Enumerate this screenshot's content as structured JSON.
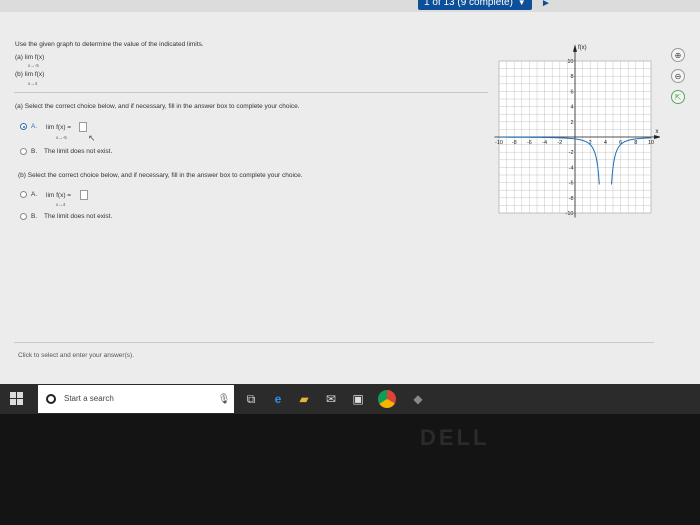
{
  "progress": {
    "label": "1 of 13 (9 complete)"
  },
  "question": {
    "instruction": "Use the given graph to determine the value of the indicated limits.",
    "parts": [
      {
        "label": "(a)",
        "expr": "lim f(x)",
        "approach": "x→-5"
      },
      {
        "label": "(b)",
        "expr": "lim f(x)",
        "approach": "x→4"
      }
    ]
  },
  "part_a": {
    "prompt": "(a) Select the correct choice below, and if necessary, fill in the answer box to complete your choice.",
    "option_a_label": "A.",
    "option_a_expr": "lim f(x) =",
    "option_a_approach": "x→-5",
    "option_b_label": "B.",
    "option_b_text": "The limit does not exist.",
    "selected": "A"
  },
  "part_b": {
    "prompt": "(b) Select the correct choice below, and if necessary, fill in the answer box to complete your choice.",
    "option_a_label": "A.",
    "option_a_expr": "lim f(x) =",
    "option_a_approach": "x→4",
    "option_b_label": "B.",
    "option_b_text": "The limit does not exist.",
    "selected": ""
  },
  "graph": {
    "y_axis_label": "f(x)",
    "x_axis_label": "x",
    "x_ticks": [
      "-10",
      "-8",
      "-6",
      "-4",
      "-2",
      "2",
      "4",
      "6",
      "8",
      "10"
    ],
    "y_ticks": [
      "10",
      "8",
      "6",
      "4",
      "2",
      "-2",
      "-4",
      "-6",
      "-8",
      "-10"
    ],
    "range": [
      -10,
      10
    ]
  },
  "side_icons": [
    "zoom-in-icon",
    "zoom-out-icon",
    "external-link-icon"
  ],
  "footer": {
    "text": "Click to select and enter your answer(s)."
  },
  "taskbar": {
    "search_placeholder": "Start a search",
    "icons": [
      "microphone-icon",
      "task-view-icon",
      "edge-icon",
      "file-explorer-icon",
      "mail-icon",
      "store-icon",
      "chrome-icon",
      "app-icon"
    ]
  },
  "brand": "DELL",
  "colors": {
    "accent": "#0d4f98",
    "radio": "#2a6db5",
    "curve": "#1e6fb8"
  }
}
